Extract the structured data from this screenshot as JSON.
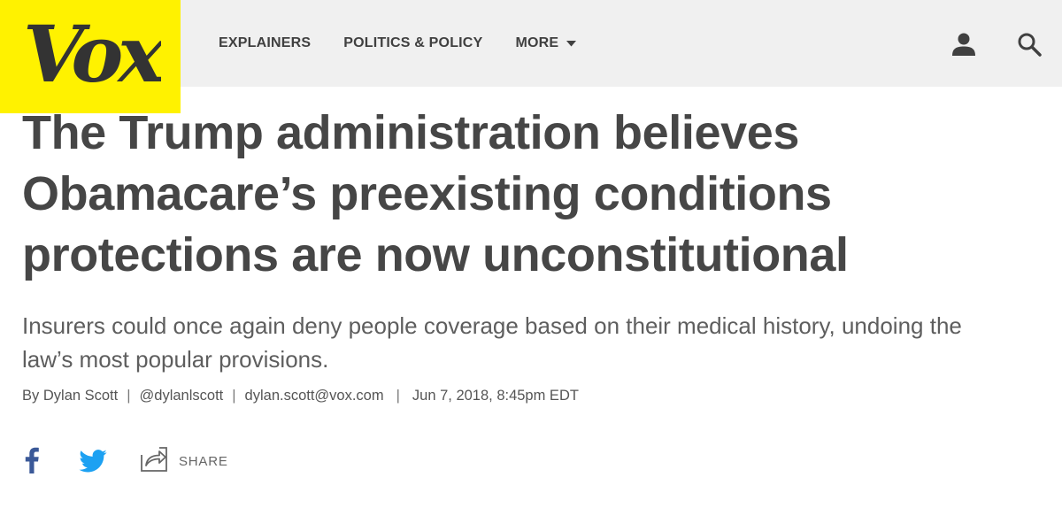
{
  "header": {
    "logo_text": "Vox",
    "nav": [
      {
        "label": "EXPLAINERS"
      },
      {
        "label": "POLITICS & POLICY"
      },
      {
        "label": "MORE"
      }
    ],
    "colors": {
      "logo_bg": "#fff200",
      "bar_bg": "#f0f0f0"
    },
    "icons": [
      "user-icon",
      "search-icon",
      "chevron-down-icon"
    ]
  },
  "article": {
    "headline": "The Trump administration believes Obamacare’s preexisting conditions protections are now unconstitutional",
    "dek": "Insurers could once again deny people coverage based on their medical history, undoing the law’s most popular provisions.",
    "byline": {
      "by": "By",
      "author": "Dylan Scott",
      "twitter": "@dylanlscott",
      "email": "dylan.scott@vox.com",
      "date": "Jun 7, 2018, 8:45pm EDT",
      "separator": "|"
    }
  },
  "share": {
    "label": "SHARE",
    "icons": [
      "facebook-icon",
      "twitter-icon",
      "share-icon"
    ],
    "colors": {
      "facebook": "#3b5998",
      "twitter": "#1da1f2"
    }
  }
}
